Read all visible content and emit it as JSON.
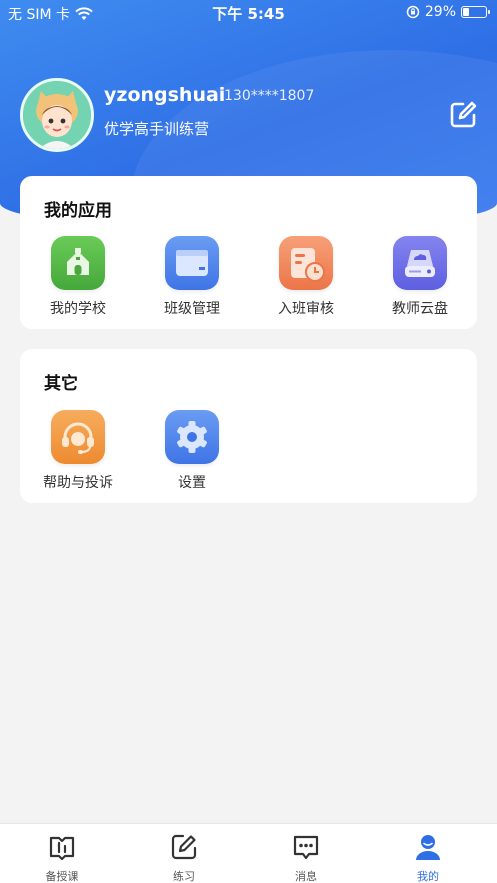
{
  "status_bar": {
    "carrier": "无 SIM 卡",
    "time": "下午 5:45",
    "battery_percent": "29%",
    "battery_level": 0.29
  },
  "profile": {
    "username": "yzongshuai",
    "phone": "130****1807",
    "org": "优学高手训练营"
  },
  "my_apps": {
    "title": "我的应用",
    "items": [
      {
        "label": "我的学校",
        "icon": "school-icon",
        "color": "#5bbd4a"
      },
      {
        "label": "班级管理",
        "icon": "class-board-icon",
        "color": "#4d86ee"
      },
      {
        "label": "入班审核",
        "icon": "review-clock-icon",
        "color": "#f08a5d"
      },
      {
        "label": "教师云盘",
        "icon": "cloud-drive-icon",
        "color": "#6c6ee8"
      }
    ]
  },
  "others": {
    "title": "其它",
    "items": [
      {
        "label": "帮助与投诉",
        "icon": "headset-icon",
        "color": "#f29b45"
      },
      {
        "label": "设置",
        "icon": "gear-icon",
        "color": "#4d86ee"
      }
    ]
  },
  "tabbar": {
    "items": [
      {
        "label": "备授课",
        "icon": "book-icon"
      },
      {
        "label": "练习",
        "icon": "pencil-square-icon"
      },
      {
        "label": "消息",
        "icon": "message-icon"
      },
      {
        "label": "我的",
        "icon": "person-icon"
      }
    ],
    "active_index": 3,
    "active_color": "#2f6fe6"
  }
}
